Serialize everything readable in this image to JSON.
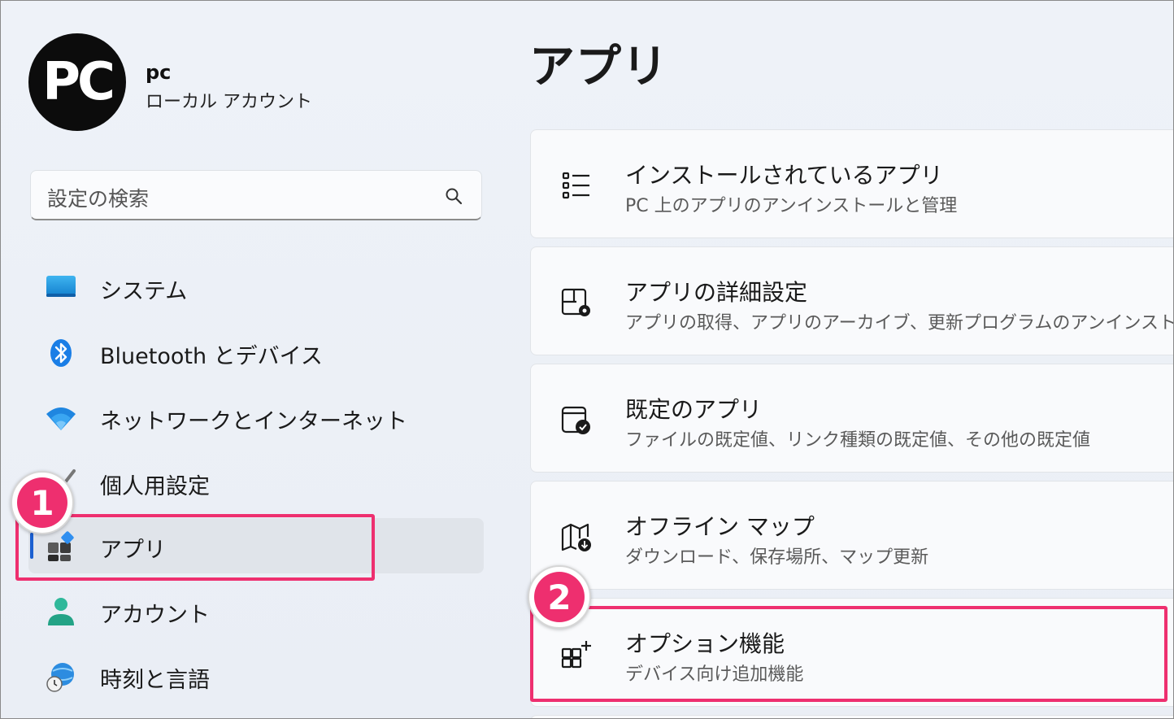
{
  "user": {
    "initials": "PC",
    "name": "pc",
    "account_type": "ローカル アカウント"
  },
  "search": {
    "placeholder": "設定の検索"
  },
  "sidebar": {
    "items": [
      {
        "label": "システム",
        "icon": "system-icon"
      },
      {
        "label": "Bluetooth とデバイス",
        "icon": "bluetooth-icon"
      },
      {
        "label": "ネットワークとインターネット",
        "icon": "wifi-icon"
      },
      {
        "label": "個人用設定",
        "icon": "brush-icon"
      },
      {
        "label": "アプリ",
        "icon": "apps-icon",
        "selected": true
      },
      {
        "label": "アカウント",
        "icon": "account-icon"
      },
      {
        "label": "時刻と言語",
        "icon": "time-language-icon"
      }
    ]
  },
  "main": {
    "title": "アプリ",
    "cards": [
      {
        "title": "インストールされているアプリ",
        "subtitle": "PC 上のアプリのアンインストールと管理",
        "icon": "list-icon"
      },
      {
        "title": "アプリの詳細設定",
        "subtitle": "アプリの取得、アプリのアーカイブ、更新プログラムのアンインストールを行う場",
        "icon": "advanced-settings-icon"
      },
      {
        "title": "既定のアプリ",
        "subtitle": "ファイルの既定値、リンク種類の既定値、その他の既定値",
        "icon": "default-apps-icon"
      },
      {
        "title": "オフライン マップ",
        "subtitle": "ダウンロード、保存場所、マップ更新",
        "icon": "offline-map-icon"
      },
      {
        "title": "オプション機能",
        "subtitle": "デバイス向け追加機能",
        "icon": "optional-features-icon"
      }
    ]
  },
  "annotations": {
    "step1": "1",
    "step2": "2",
    "highlight_color": "#ee2f6f"
  }
}
